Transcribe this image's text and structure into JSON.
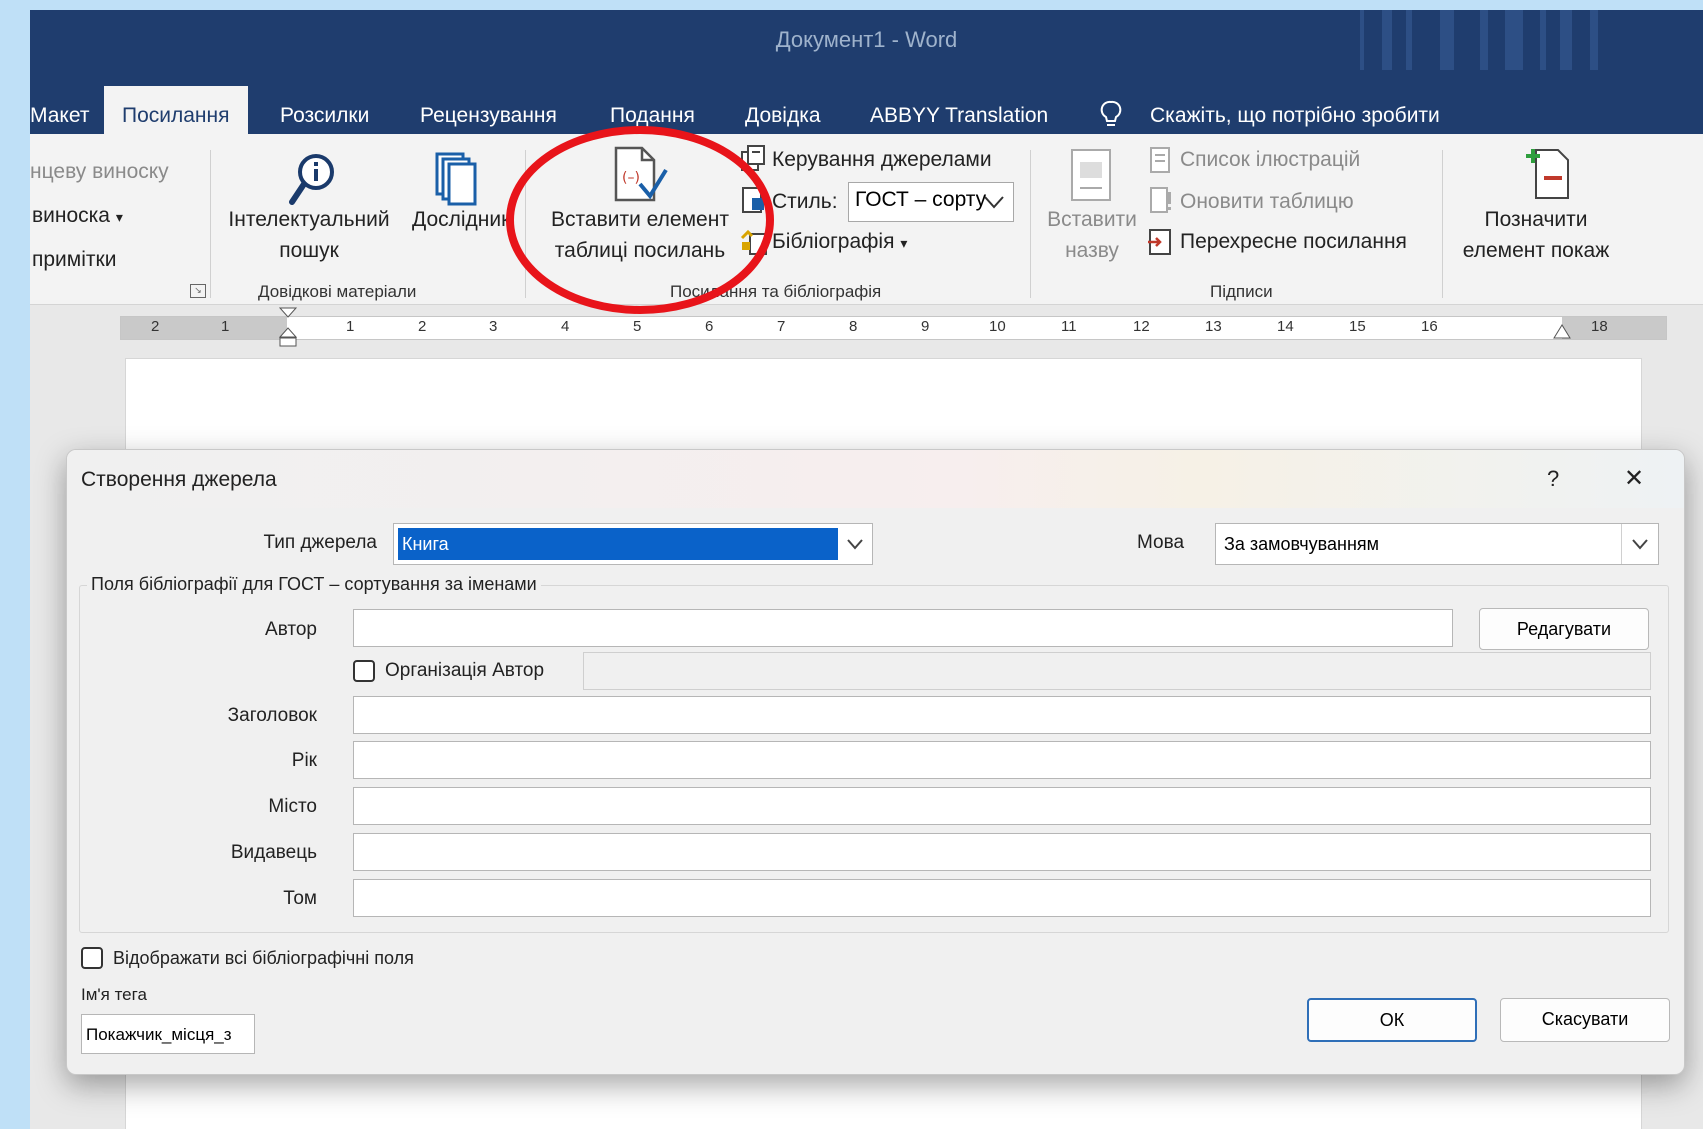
{
  "window": {
    "title": "Документ1  -  Word"
  },
  "tabs": [
    "Макет",
    "Посилання",
    "Розсилки",
    "Рецензування",
    "Подання",
    "Довідка",
    "ABBYY Translation"
  ],
  "tell_me": "Скажіть, що потрібно зробити",
  "ribbon": {
    "footnotes": {
      "item1": "нцеву виноску",
      "item2": "виноска",
      "item3": "примітки"
    },
    "research": {
      "smart_lookup_line1": "Інтелектуальний",
      "smart_lookup_line2": "пошук",
      "researcher": "Дослідник",
      "group_label": "Довідкові матеріали"
    },
    "citations": {
      "insert_citation_line1": "Вставити елемент",
      "insert_citation_line2": "таблиці посилань",
      "manage_sources": "Керування джерелами",
      "style_label": "Стиль:",
      "style_value": "ГОСТ – сорту",
      "bibliography": "Бібліографія",
      "group_label": "Посилання та бібліографія"
    },
    "captions": {
      "insert_caption_line1": "Вставити",
      "insert_caption_line2": "назву",
      "list_of_figures": "Список ілюстрацій",
      "update_table": "Оновити таблицю",
      "cross_reference": "Перехресне посилання",
      "group_label": "Підписи"
    },
    "index": {
      "mark_entry_line1": "Позначити",
      "mark_entry_line2": "елемент покаж"
    }
  },
  "ruler": {
    "numbers": [
      "2",
      "1",
      "1",
      "2",
      "3",
      "4",
      "5",
      "6",
      "7",
      "8",
      "9",
      "10",
      "11",
      "12",
      "13",
      "14",
      "15",
      "16",
      "18"
    ]
  },
  "dialog": {
    "title": "Створення джерела",
    "help": "?",
    "close": "✕",
    "source_type_label": "Тип джерела",
    "source_type_value": "Книга",
    "language_label": "Мова",
    "language_value": "За замовчуванням",
    "fields_legend": "Поля бібліографії для ГОСТ – сортування за іменами",
    "author_label": "Автор",
    "edit_button": "Редагувати",
    "org_author_label": "Організація Автор",
    "title_label": "Заголовок",
    "year_label": "Рік",
    "city_label": "Місто",
    "publisher_label": "Видавець",
    "volume_label": "Том",
    "show_all_label": "Відображати всі бібліографічні поля",
    "tag_name_label": "Ім'я тега",
    "tag_name_value": "Покажчик_місця_з",
    "ok_button": "ОК",
    "cancel_button": "Скасувати"
  },
  "colors": {
    "titlebar": "#1f3d6e",
    "highlight": "#0a62c9",
    "annotation_circle": "#e8141a"
  }
}
